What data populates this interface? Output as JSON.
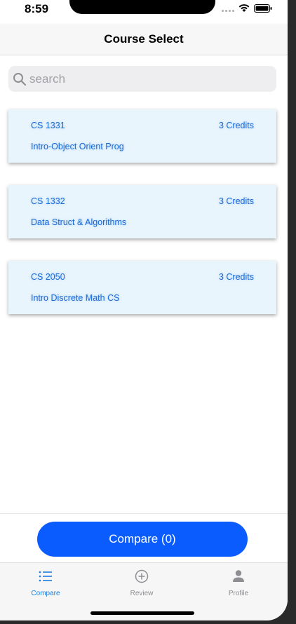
{
  "status_bar": {
    "time": "8:59"
  },
  "nav": {
    "title": "Course Select"
  },
  "search": {
    "placeholder": "search",
    "value": ""
  },
  "courses": [
    {
      "code": "CS 1331",
      "credits": "3 Credits",
      "name": "Intro-Object Orient Prog"
    },
    {
      "code": "CS 1332",
      "credits": "3 Credits",
      "name": "Data Struct & Algorithms"
    },
    {
      "code": "CS 2050",
      "credits": "3 Credits",
      "name": "Intro Discrete Math CS"
    }
  ],
  "compare_button": {
    "label": "Compare (0)"
  },
  "tabs": [
    {
      "label": "Compare",
      "icon": "list-icon",
      "active": true
    },
    {
      "label": "Review",
      "icon": "plus-circle-icon",
      "active": false
    },
    {
      "label": "Profile",
      "icon": "person-icon",
      "active": false
    }
  ],
  "colors": {
    "accent": "#0a5cff",
    "card_bg": "#e9f5fd",
    "card_text": "#1a6ad6",
    "tab_active": "#1a7ee0",
    "tab_inactive": "#8e8e93"
  }
}
